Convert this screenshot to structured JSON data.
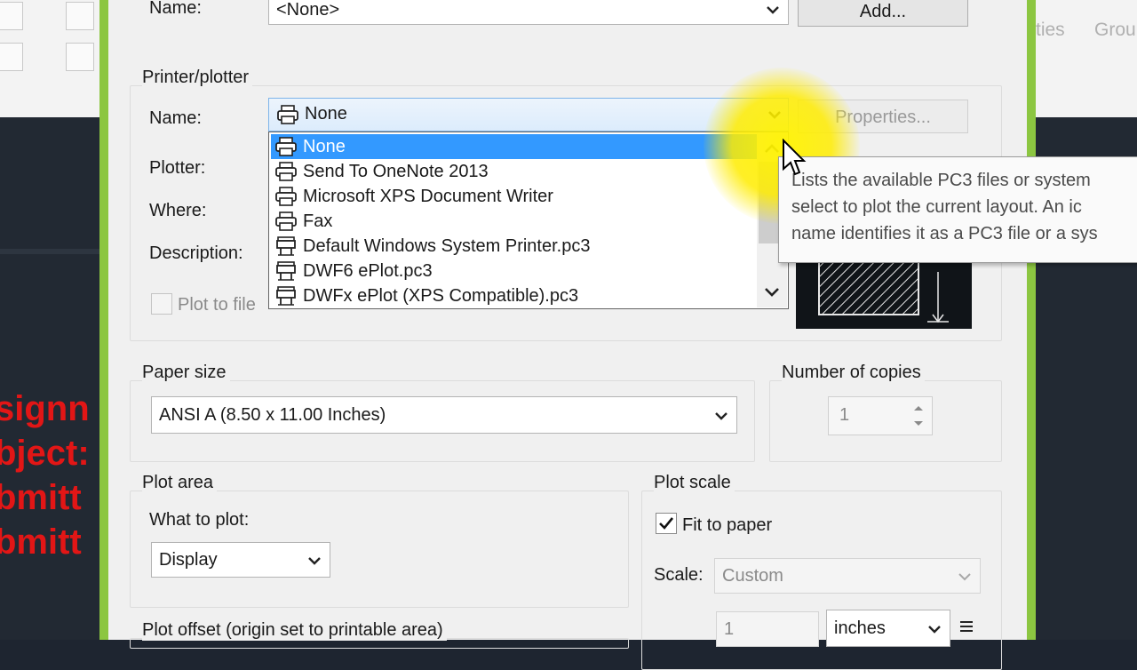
{
  "background_app": {
    "ribbon_labels": [
      "ties",
      "Grou"
    ],
    "red_text_lines": [
      "signn",
      "bject:",
      "bmitt",
      "bmitt"
    ]
  },
  "page_setup": {
    "name_label": "Name:",
    "name_value": "<None>",
    "add_button": "Add..."
  },
  "printer_plotter": {
    "group_label": "Printer/plotter",
    "name_label": "Name:",
    "selected": "None",
    "properties_button": "Properties...",
    "plotter_label": "Plotter:",
    "where_label": "Where:",
    "description_label": "Description:",
    "plot_to_file_label": "Plot to file",
    "list_items": [
      {
        "label": "None",
        "icon": "printer-icon",
        "selected": true
      },
      {
        "label": "Send To OneNote 2013",
        "icon": "printer-icon",
        "selected": false
      },
      {
        "label": "Microsoft XPS Document Writer",
        "icon": "printer-icon",
        "selected": false
      },
      {
        "label": "Fax",
        "icon": "printer-icon",
        "selected": false
      },
      {
        "label": "Default Windows System Printer.pc3",
        "icon": "plotter-icon",
        "selected": false
      },
      {
        "label": "DWF6 ePlot.pc3",
        "icon": "plotter-icon",
        "selected": false
      },
      {
        "label": "DWFx ePlot (XPS Compatible).pc3",
        "icon": "plotter-icon",
        "selected": false
      }
    ],
    "tooltip_lines": [
      "Lists the available PC3 files or system",
      "select to plot the current layout. An ic",
      "name identifies it as a PC3 file or a sys"
    ]
  },
  "paper_size": {
    "label": "Paper size",
    "value": "ANSI A (8.50 x 11.00 Inches)"
  },
  "copies": {
    "label": "Number of copies",
    "value": "1"
  },
  "plot_area": {
    "label": "Plot area",
    "what_label": "What to plot:",
    "what_value": "Display"
  },
  "plot_scale": {
    "label": "Plot scale",
    "fit_label": "Fit to paper",
    "fit_checked": true,
    "scale_label": "Scale:",
    "scale_value": "Custom",
    "scale_num": "1",
    "units": "inches"
  },
  "plot_offset": {
    "label": "Plot offset (origin set to printable area)"
  },
  "colors": {
    "frame_green": "#8cc641",
    "selection_blue": "#3399ff",
    "highlight_yellow": "#ffec00",
    "red_text": "#e21616"
  }
}
